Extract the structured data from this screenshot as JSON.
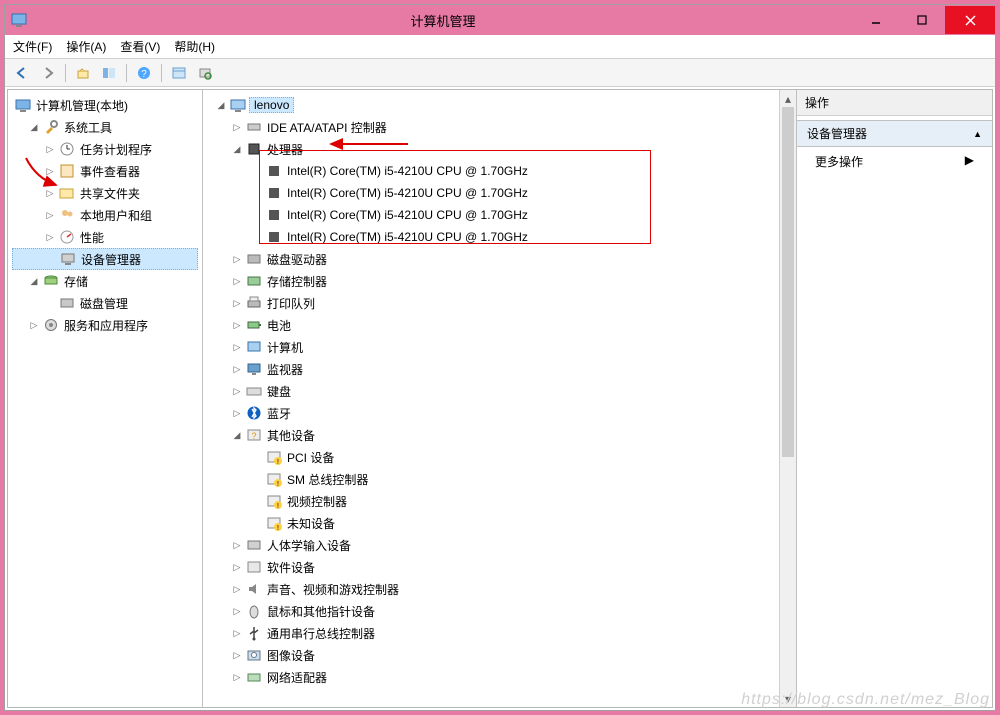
{
  "window": {
    "title": "计算机管理"
  },
  "menubar": [
    "文件(F)",
    "操作(A)",
    "查看(V)",
    "帮助(H)"
  ],
  "left_tree": {
    "root": "计算机管理(本地)",
    "system_tools": "系统工具",
    "task_scheduler": "任务计划程序",
    "event_viewer": "事件查看器",
    "shared_folders": "共享文件夹",
    "local_users": "本地用户和组",
    "performance": "性能",
    "device_manager": "设备管理器",
    "storage": "存储",
    "disk_mgmt": "磁盘管理",
    "services_apps": "服务和应用程序"
  },
  "center_tree": {
    "root": "lenovo",
    "ide": "IDE ATA/ATAPI 控制器",
    "cpu": "处理器",
    "cpu_items": [
      "Intel(R) Core(TM) i5-4210U CPU @ 1.70GHz",
      "Intel(R) Core(TM) i5-4210U CPU @ 1.70GHz",
      "Intel(R) Core(TM) i5-4210U CPU @ 1.70GHz",
      "Intel(R) Core(TM) i5-4210U CPU @ 1.70GHz"
    ],
    "disk_drives": "磁盘驱动器",
    "storage_ctrl": "存储控制器",
    "print_queue": "打印队列",
    "battery": "电池",
    "computer": "计算机",
    "monitor": "监视器",
    "keyboard": "键盘",
    "bluetooth": "蓝牙",
    "other_devices": "其他设备",
    "other_items": [
      "PCI 设备",
      "SM 总线控制器",
      "视频控制器",
      "未知设备"
    ],
    "hid": "人体学输入设备",
    "software_dev": "软件设备",
    "sound": "声音、视频和游戏控制器",
    "mouse": "鼠标和其他指针设备",
    "usb": "通用串行总线控制器",
    "imaging": "图像设备",
    "network": "网络适配器"
  },
  "actions": {
    "header": "操作",
    "section": "设备管理器",
    "more": "更多操作"
  },
  "watermark": "https://blog.csdn.net/mez_Blog"
}
